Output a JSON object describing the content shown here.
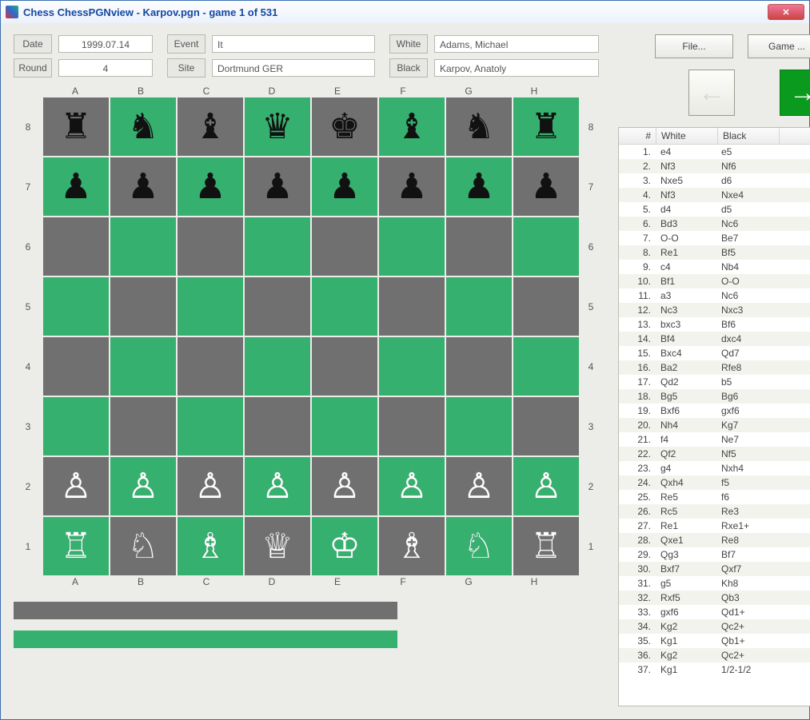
{
  "title": "Chess ChessPGNview - Karpov.pgn - game 1 of 531",
  "labels": {
    "date": "Date",
    "round": "Round",
    "event": "Event",
    "site": "Site",
    "white": "White",
    "black": "Black"
  },
  "info": {
    "date": "1999.07.14",
    "round": "4",
    "event": "It",
    "site": "Dortmund GER",
    "white": "Adams, Michael",
    "black": "Karpov, Anatoly"
  },
  "buttons": {
    "file": "File...",
    "game": "Game ..."
  },
  "files": [
    "A",
    "B",
    "C",
    "D",
    "E",
    "F",
    "G",
    "H"
  ],
  "ranks": [
    "8",
    "7",
    "6",
    "5",
    "4",
    "3",
    "2",
    "1"
  ],
  "board": [
    [
      "br",
      "bn",
      "bb",
      "bq",
      "bk",
      "bb",
      "bn",
      "br"
    ],
    [
      "bp",
      "bp",
      "bp",
      "bp",
      "bp",
      "bp",
      "bp",
      "bp"
    ],
    [
      "",
      "",
      "",
      "",
      "",
      "",
      "",
      ""
    ],
    [
      "",
      "",
      "",
      "",
      "",
      "",
      "",
      ""
    ],
    [
      "",
      "",
      "",
      "",
      "",
      "",
      "",
      ""
    ],
    [
      "",
      "",
      "",
      "",
      "",
      "",
      "",
      ""
    ],
    [
      "wp",
      "wp",
      "wp",
      "wp",
      "wp",
      "wp",
      "wp",
      "wp"
    ],
    [
      "wr",
      "wn",
      "wb",
      "wq",
      "wk",
      "wb",
      "wn",
      "wr"
    ]
  ],
  "piece_glyph": {
    "wk": "♔",
    "wq": "♕",
    "wr": "♖",
    "wb": "♗",
    "wn": "♘",
    "wp": "♙",
    "bk": "♚",
    "bq": "♛",
    "br": "♜",
    "bb": "♝",
    "bn": "♞",
    "bp": "♟"
  },
  "moves_head": {
    "num": "#",
    "white": "White",
    "black": "Black"
  },
  "moves": [
    {
      "n": 1,
      "w": "e4",
      "b": "e5"
    },
    {
      "n": 2,
      "w": "Nf3",
      "b": "Nf6"
    },
    {
      "n": 3,
      "w": "Nxe5",
      "b": "d6"
    },
    {
      "n": 4,
      "w": "Nf3",
      "b": "Nxe4"
    },
    {
      "n": 5,
      "w": "d4",
      "b": "d5"
    },
    {
      "n": 6,
      "w": "Bd3",
      "b": "Nc6"
    },
    {
      "n": 7,
      "w": "O-O",
      "b": "Be7"
    },
    {
      "n": 8,
      "w": "Re1",
      "b": "Bf5"
    },
    {
      "n": 9,
      "w": "c4",
      "b": "Nb4"
    },
    {
      "n": 10,
      "w": "Bf1",
      "b": "O-O"
    },
    {
      "n": 11,
      "w": "a3",
      "b": "Nc6"
    },
    {
      "n": 12,
      "w": "Nc3",
      "b": "Nxc3"
    },
    {
      "n": 13,
      "w": "bxc3",
      "b": "Bf6"
    },
    {
      "n": 14,
      "w": "Bf4",
      "b": "dxc4"
    },
    {
      "n": 15,
      "w": "Bxc4",
      "b": "Qd7"
    },
    {
      "n": 16,
      "w": "Ba2",
      "b": "Rfe8"
    },
    {
      "n": 17,
      "w": "Qd2",
      "b": "b5"
    },
    {
      "n": 18,
      "w": "Bg5",
      "b": "Bg6"
    },
    {
      "n": 19,
      "w": "Bxf6",
      "b": "gxf6"
    },
    {
      "n": 20,
      "w": "Nh4",
      "b": "Kg7"
    },
    {
      "n": 21,
      "w": "f4",
      "b": "Ne7"
    },
    {
      "n": 22,
      "w": "Qf2",
      "b": "Nf5"
    },
    {
      "n": 23,
      "w": "g4",
      "b": "Nxh4"
    },
    {
      "n": 24,
      "w": "Qxh4",
      "b": "f5"
    },
    {
      "n": 25,
      "w": "Re5",
      "b": "f6"
    },
    {
      "n": 26,
      "w": "Rc5",
      "b": "Re3"
    },
    {
      "n": 27,
      "w": "Re1",
      "b": "Rxe1+"
    },
    {
      "n": 28,
      "w": "Qxe1",
      "b": "Re8"
    },
    {
      "n": 29,
      "w": "Qg3",
      "b": "Bf7"
    },
    {
      "n": 30,
      "w": "Bxf7",
      "b": "Qxf7"
    },
    {
      "n": 31,
      "w": "g5",
      "b": "Kh8"
    },
    {
      "n": 32,
      "w": "Rxf5",
      "b": "Qb3"
    },
    {
      "n": 33,
      "w": "gxf6",
      "b": "Qd1+"
    },
    {
      "n": 34,
      "w": "Kg2",
      "b": "Qc2+"
    },
    {
      "n": 35,
      "w": "Kg1",
      "b": "Qb1+"
    },
    {
      "n": 36,
      "w": "Kg2",
      "b": "Qc2+"
    },
    {
      "n": 37,
      "w": "Kg1",
      "b": "1/2-1/2"
    }
  ]
}
